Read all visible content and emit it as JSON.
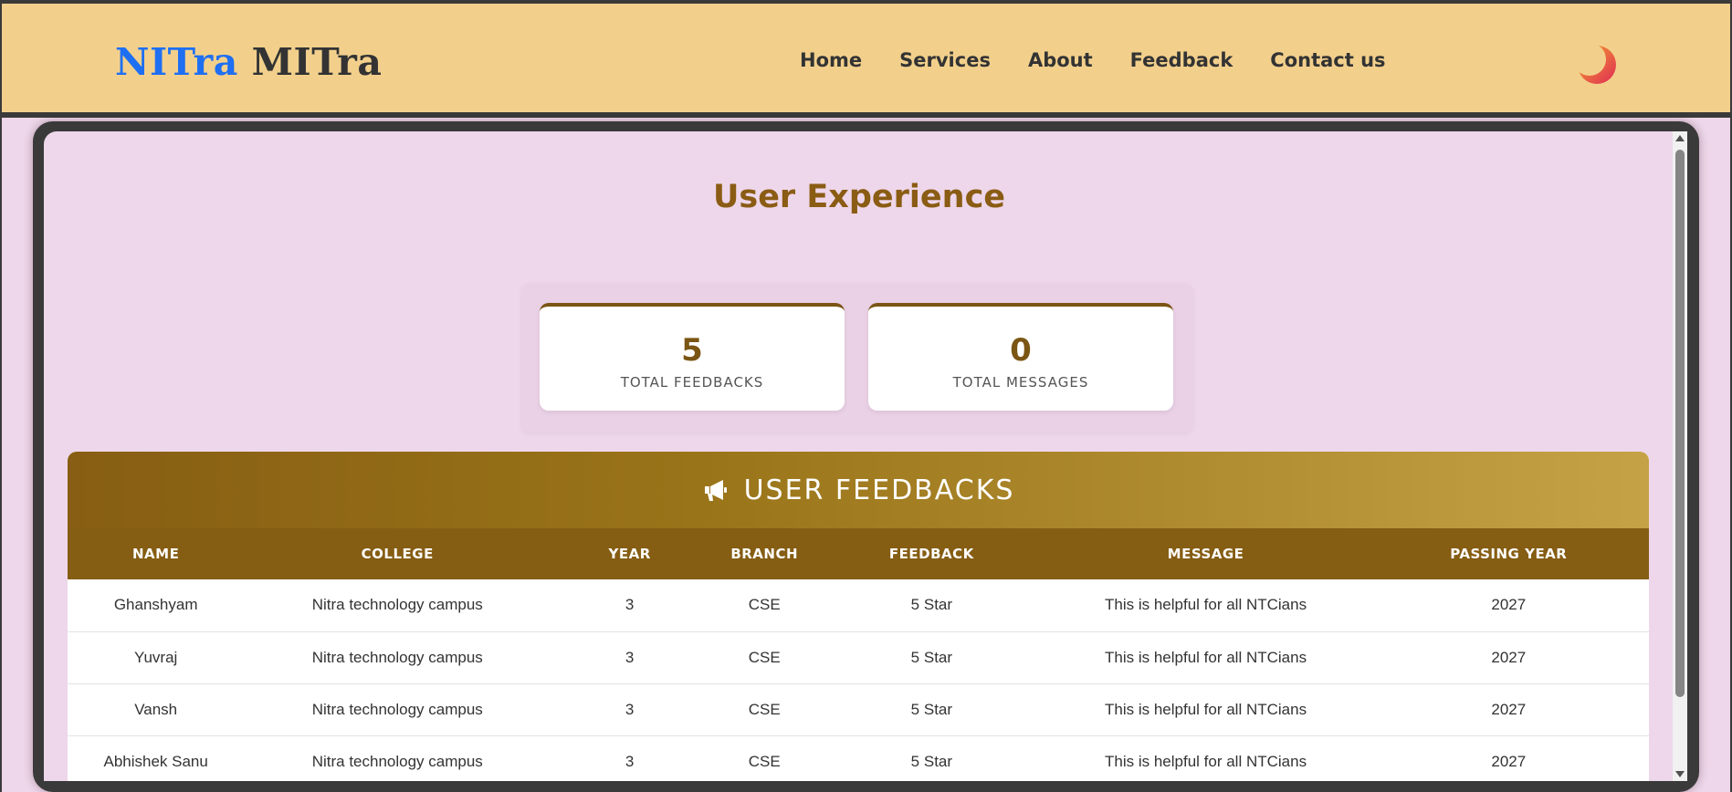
{
  "brand": {
    "part1": "NITra",
    "part2": "MITra"
  },
  "nav": {
    "items": [
      {
        "label": "Home"
      },
      {
        "label": "Services"
      },
      {
        "label": "About"
      },
      {
        "label": "Feedback"
      },
      {
        "label": "Contact us"
      }
    ],
    "theme_icon": "moon-icon"
  },
  "main": {
    "title": "User Experience",
    "stats": [
      {
        "value": "5",
        "label": "TOTAL FEEDBACKS"
      },
      {
        "value": "0",
        "label": "TOTAL MESSAGES"
      }
    ],
    "feedbacks": {
      "icon": "megaphone-icon",
      "title": "USER FEEDBACKS",
      "columns": [
        "NAME",
        "COLLEGE",
        "YEAR",
        "BRANCH",
        "FEEDBACK",
        "MESSAGE",
        "PASSING YEAR"
      ],
      "rows": [
        [
          "Ghanshyam",
          "Nitra technology campus",
          "3",
          "CSE",
          "5 Star",
          "This is helpful for all NTCians",
          "2027"
        ],
        [
          "Yuvraj",
          "Nitra technology campus",
          "3",
          "CSE",
          "5 Star",
          "This is helpful for all NTCians",
          "2027"
        ],
        [
          "Vansh",
          "Nitra technology campus",
          "3",
          "CSE",
          "5 Star",
          "This is helpful for all NTCians",
          "2027"
        ],
        [
          "Abhishek Sanu",
          "Nitra technology campus",
          "3",
          "CSE",
          "5 Star",
          "This is helpful for all NTCians",
          "2027"
        ]
      ]
    }
  },
  "colors": {
    "header_bg": "#f2d08c",
    "page_bg": "#eed7ea",
    "accent": "#8a5c14",
    "brand_blue": "#1e6ff2"
  }
}
